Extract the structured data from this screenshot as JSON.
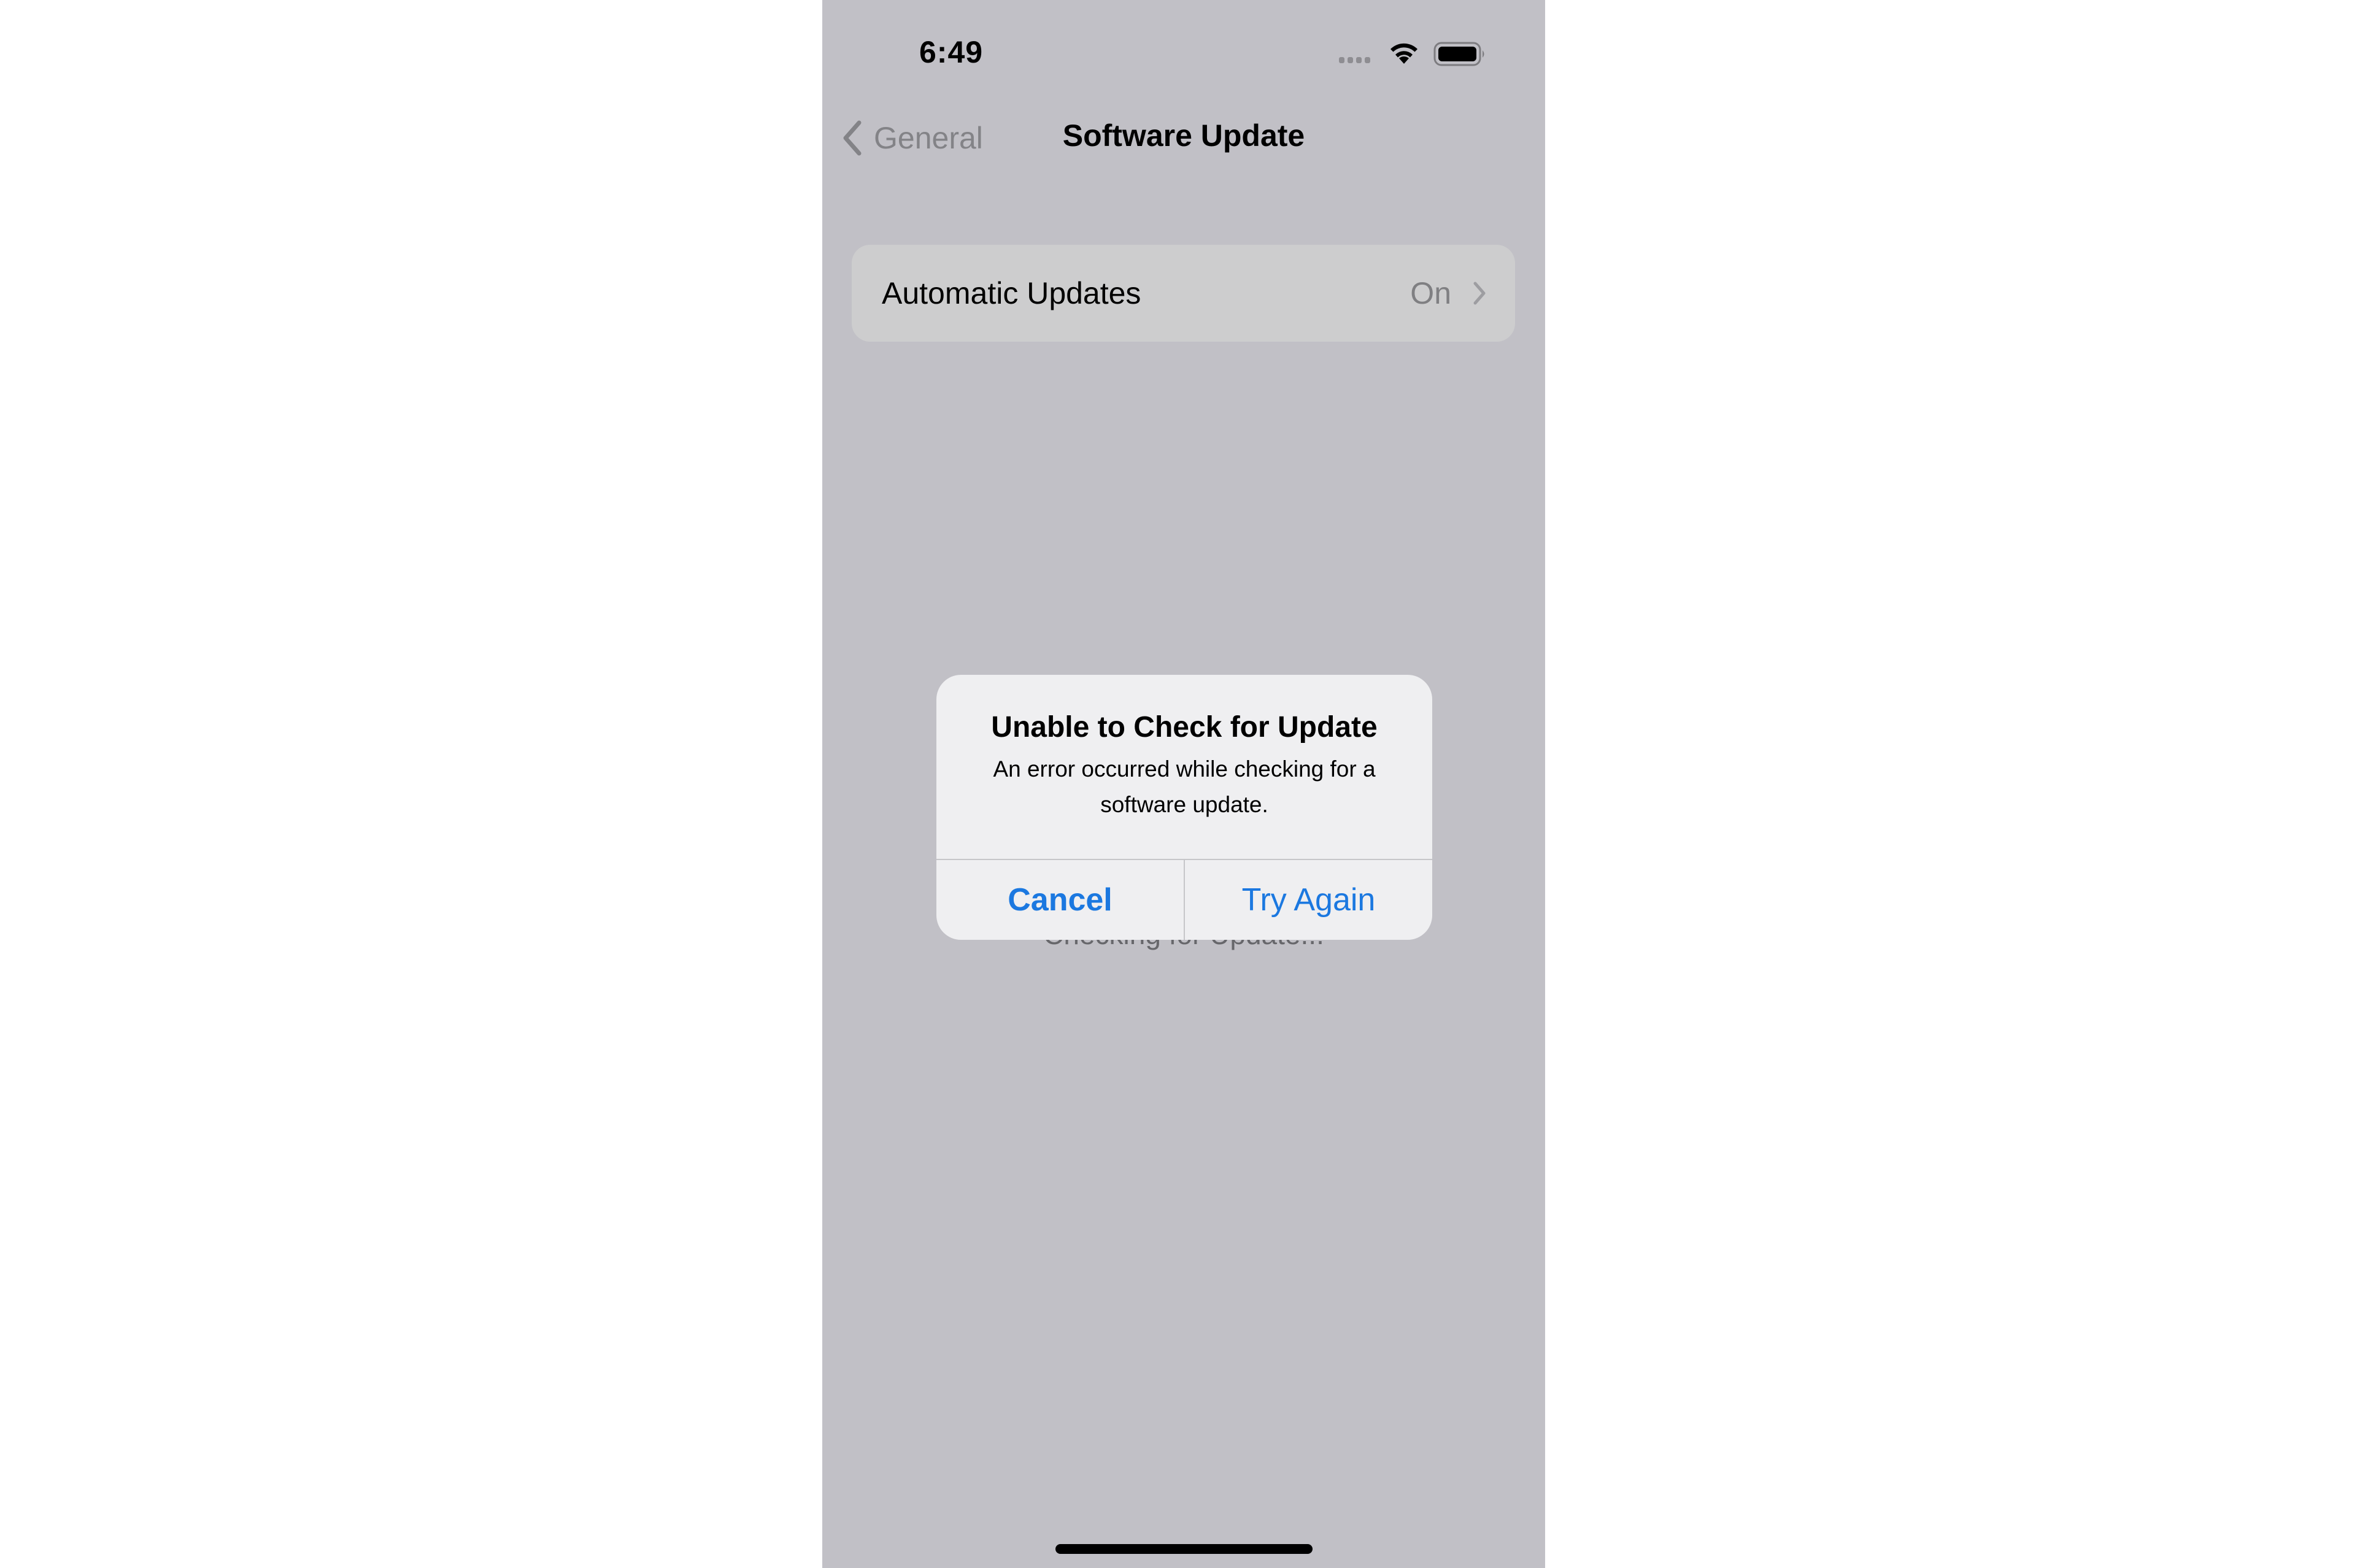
{
  "status_bar": {
    "time": "6:49",
    "icons": [
      "signal-dots-icon",
      "wifi-icon",
      "battery-icon"
    ]
  },
  "nav": {
    "back_label": "General",
    "back_icon": "chevron-left-icon",
    "title": "Software Update"
  },
  "settings": {
    "items": [
      {
        "label": "Automatic Updates",
        "value": "On",
        "icon": "chevron-right-icon"
      }
    ]
  },
  "background_status": "Checking for Update...",
  "alert": {
    "title": "Unable to Check for Update",
    "message": "An error occurred while checking for a software update.",
    "buttons": [
      {
        "label": "Cancel",
        "style": "bold"
      },
      {
        "label": "Try Again",
        "style": "regular"
      }
    ]
  },
  "colors": {
    "accent": "#1b78e0",
    "dimmed_background": "#c1c0c6",
    "alert_background": "#efeff1"
  }
}
